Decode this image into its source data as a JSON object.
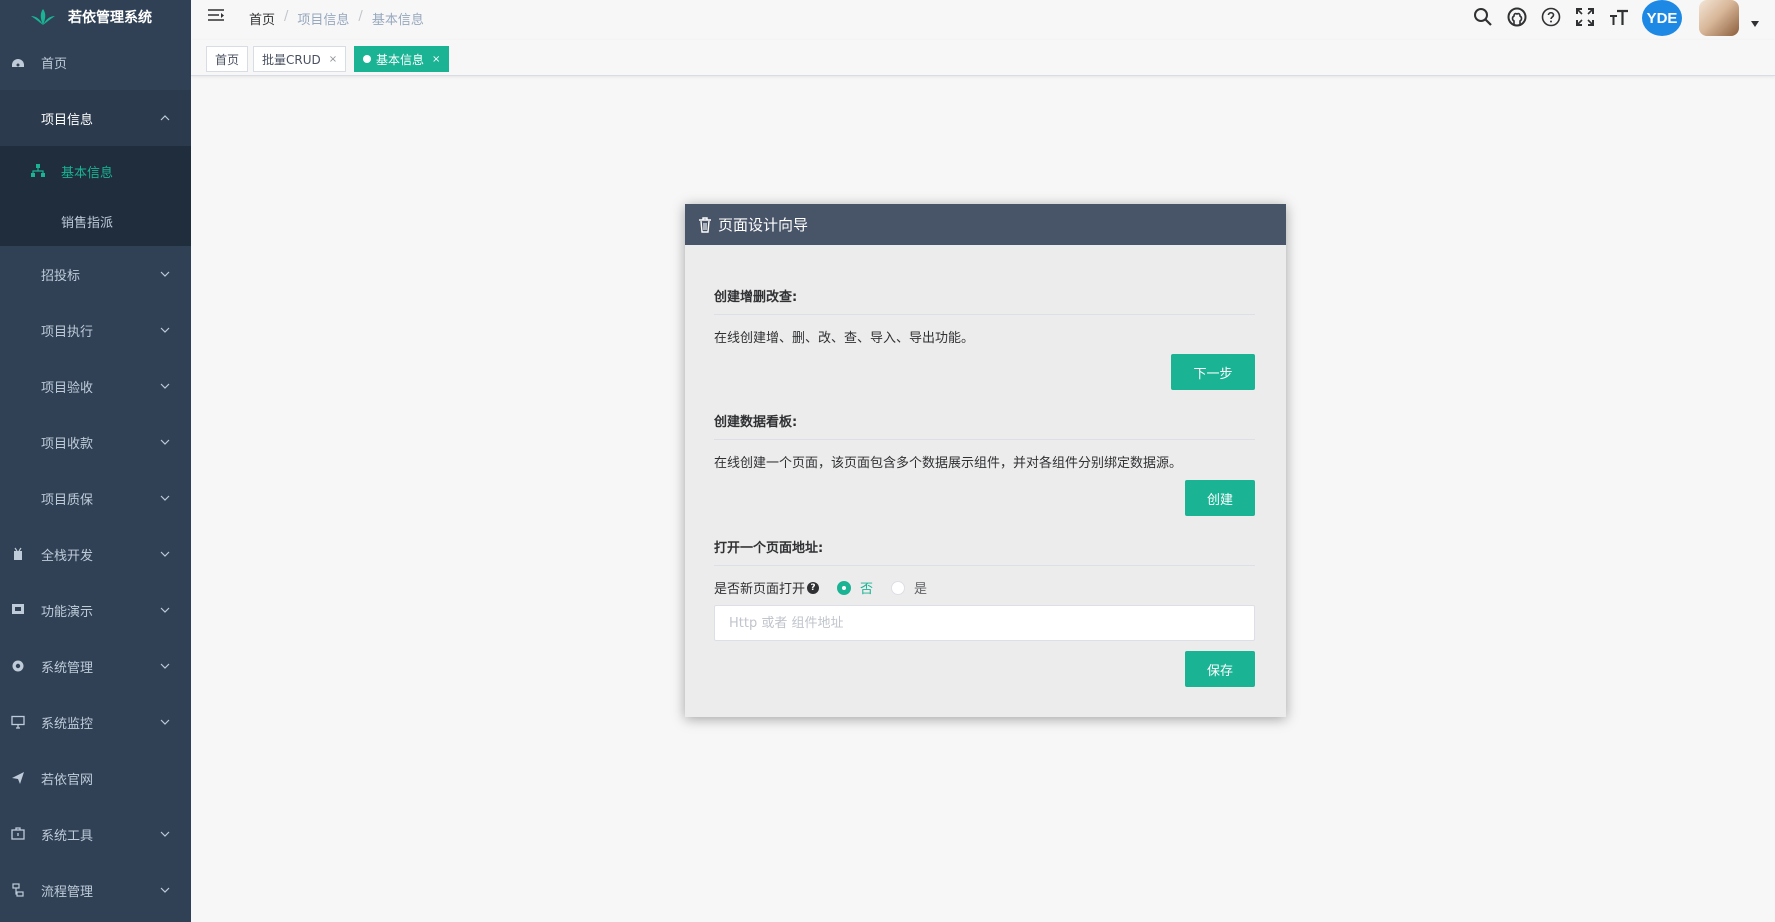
{
  "app": {
    "title": "若依管理系统"
  },
  "sidebar": {
    "items": [
      {
        "label": "首页",
        "icon": "dashboard-icon"
      },
      {
        "label": "项目信息",
        "icon": "none",
        "expanded": true,
        "children": [
          {
            "label": "基本信息",
            "icon": "tree-icon",
            "active": true
          },
          {
            "label": "销售指派"
          }
        ]
      },
      {
        "label": "招投标"
      },
      {
        "label": "项目执行"
      },
      {
        "label": "项目验收"
      },
      {
        "label": "项目收款"
      },
      {
        "label": "项目质保"
      },
      {
        "label": "全栈开发",
        "icon": "code-icon"
      },
      {
        "label": "功能演示",
        "icon": "example-icon"
      },
      {
        "label": "系统管理",
        "icon": "gear-icon"
      },
      {
        "label": "系统监控",
        "icon": "monitor-icon"
      },
      {
        "label": "若依官网",
        "icon": "send-icon"
      },
      {
        "label": "系统工具",
        "icon": "tool-icon"
      },
      {
        "label": "流程管理",
        "icon": "flow-icon"
      }
    ]
  },
  "header": {
    "breadcrumb": [
      "首页",
      "项目信息",
      "基本信息"
    ],
    "breadcrumb_separator": "/",
    "user_badge": "YDE"
  },
  "tags": [
    {
      "label": "首页"
    },
    {
      "label": "批量CRUD",
      "close": "×"
    },
    {
      "label": "基本信息",
      "close": "×",
      "active": true
    }
  ],
  "dialog": {
    "title": "页面设计向导",
    "crud": {
      "title": "创建增删改查:",
      "desc": "在线创建增、删、改、查、导入、导出功能。",
      "button": "下一步"
    },
    "board": {
      "title": "创建数据看板:",
      "desc": "在线创建一个页面，该页面包含多个数据展示组件，并对各组件分别绑定数据源。",
      "button": "创建"
    },
    "open_page": {
      "title": "打开一个页面地址:",
      "new_window_label": "是否新页面打开",
      "help_glyph": "?",
      "options": [
        "否",
        "是"
      ],
      "selected": "否",
      "url_value": "",
      "url_placeholder": "Http 或者 组件地址",
      "button": "保存"
    }
  },
  "colors": {
    "sidebar_bg": "#304156",
    "sidebar_sub_bg": "#1f2d3d",
    "accent": "#1ab394",
    "dialog_header": "#485468",
    "badge": "#1e88e5"
  }
}
